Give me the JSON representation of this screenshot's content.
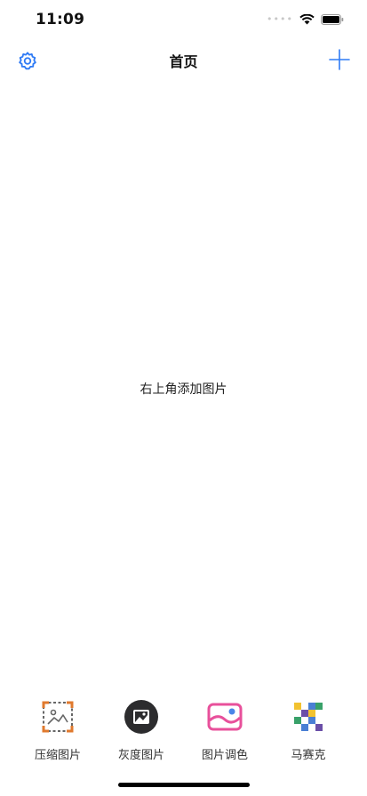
{
  "status_bar": {
    "time": "11:09"
  },
  "nav": {
    "title": "首页",
    "settings_icon": "gear-icon",
    "add_icon": "plus-icon",
    "accent_color": "#2f7bf5"
  },
  "main": {
    "empty_hint": "右上角添加图片"
  },
  "tabs": [
    {
      "label": "压缩图片",
      "icon": "compress-image-icon"
    },
    {
      "label": "灰度图片",
      "icon": "grayscale-image-icon"
    },
    {
      "label": "图片调色",
      "icon": "color-adjust-icon"
    },
    {
      "label": "马赛克",
      "icon": "mosaic-icon"
    }
  ]
}
